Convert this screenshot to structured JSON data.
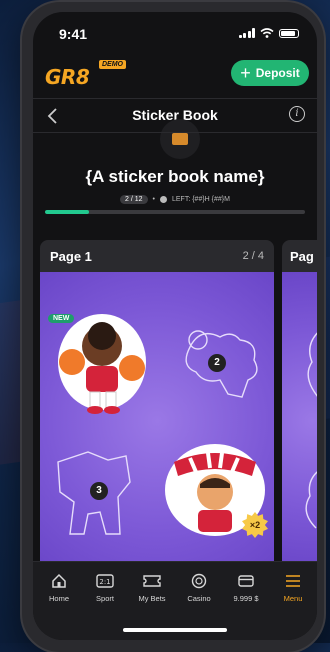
{
  "status_bar": {
    "time": "9:41"
  },
  "header": {
    "logo_text": "GR8",
    "demo_label": "DEMO",
    "deposit_label": "Deposit",
    "accent_color": "#f5a623",
    "deposit_color": "#22b573"
  },
  "nav": {
    "title": "Sticker Book",
    "back_icon": "chevron-left-icon",
    "info_icon": "info-icon"
  },
  "book": {
    "name": "{A sticker book name}",
    "collected": "2 / 12",
    "time_left": "LEFT: {##}H {##}M",
    "progress_fraction": 0.17
  },
  "pages": [
    {
      "title": "Page 1",
      "count": "2 / 4",
      "stickers": [
        {
          "state": "collected",
          "badge": "NEW"
        },
        {
          "state": "empty",
          "number": "2"
        },
        {
          "state": "empty",
          "number": "3"
        },
        {
          "state": "collected",
          "duplicates": "×2"
        }
      ]
    },
    {
      "title": "Pag"
    }
  ],
  "tabbar": {
    "items": [
      {
        "label": "Home",
        "icon": "home-icon"
      },
      {
        "label": "Sport",
        "icon": "scoreboard-icon"
      },
      {
        "label": "My Bets",
        "icon": "ticket-icon"
      },
      {
        "label": "Casino",
        "icon": "chip-icon"
      },
      {
        "label": "9.999 $",
        "icon": "wallet-icon"
      },
      {
        "label": "Menu",
        "icon": "menu-icon",
        "active": true
      }
    ]
  }
}
